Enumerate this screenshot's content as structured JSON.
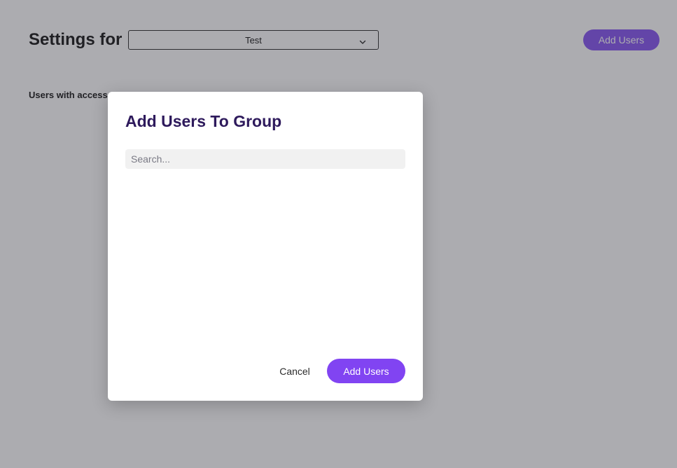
{
  "page": {
    "title_prefix": "Settings for",
    "group_select": {
      "selected_value": "Test"
    },
    "add_users_label": "Add Users",
    "users_access_label": "Users with access"
  },
  "modal": {
    "title": "Add Users To Group",
    "search": {
      "placeholder": "Search...",
      "value": ""
    },
    "cancel_label": "Cancel",
    "add_users_label": "Add Users"
  },
  "colors": {
    "accent": "#7a44f0",
    "modal_title": "#2e1a5c",
    "overlay": "#464850"
  },
  "icons": {
    "select_indicator": "chevron-down-icon"
  }
}
